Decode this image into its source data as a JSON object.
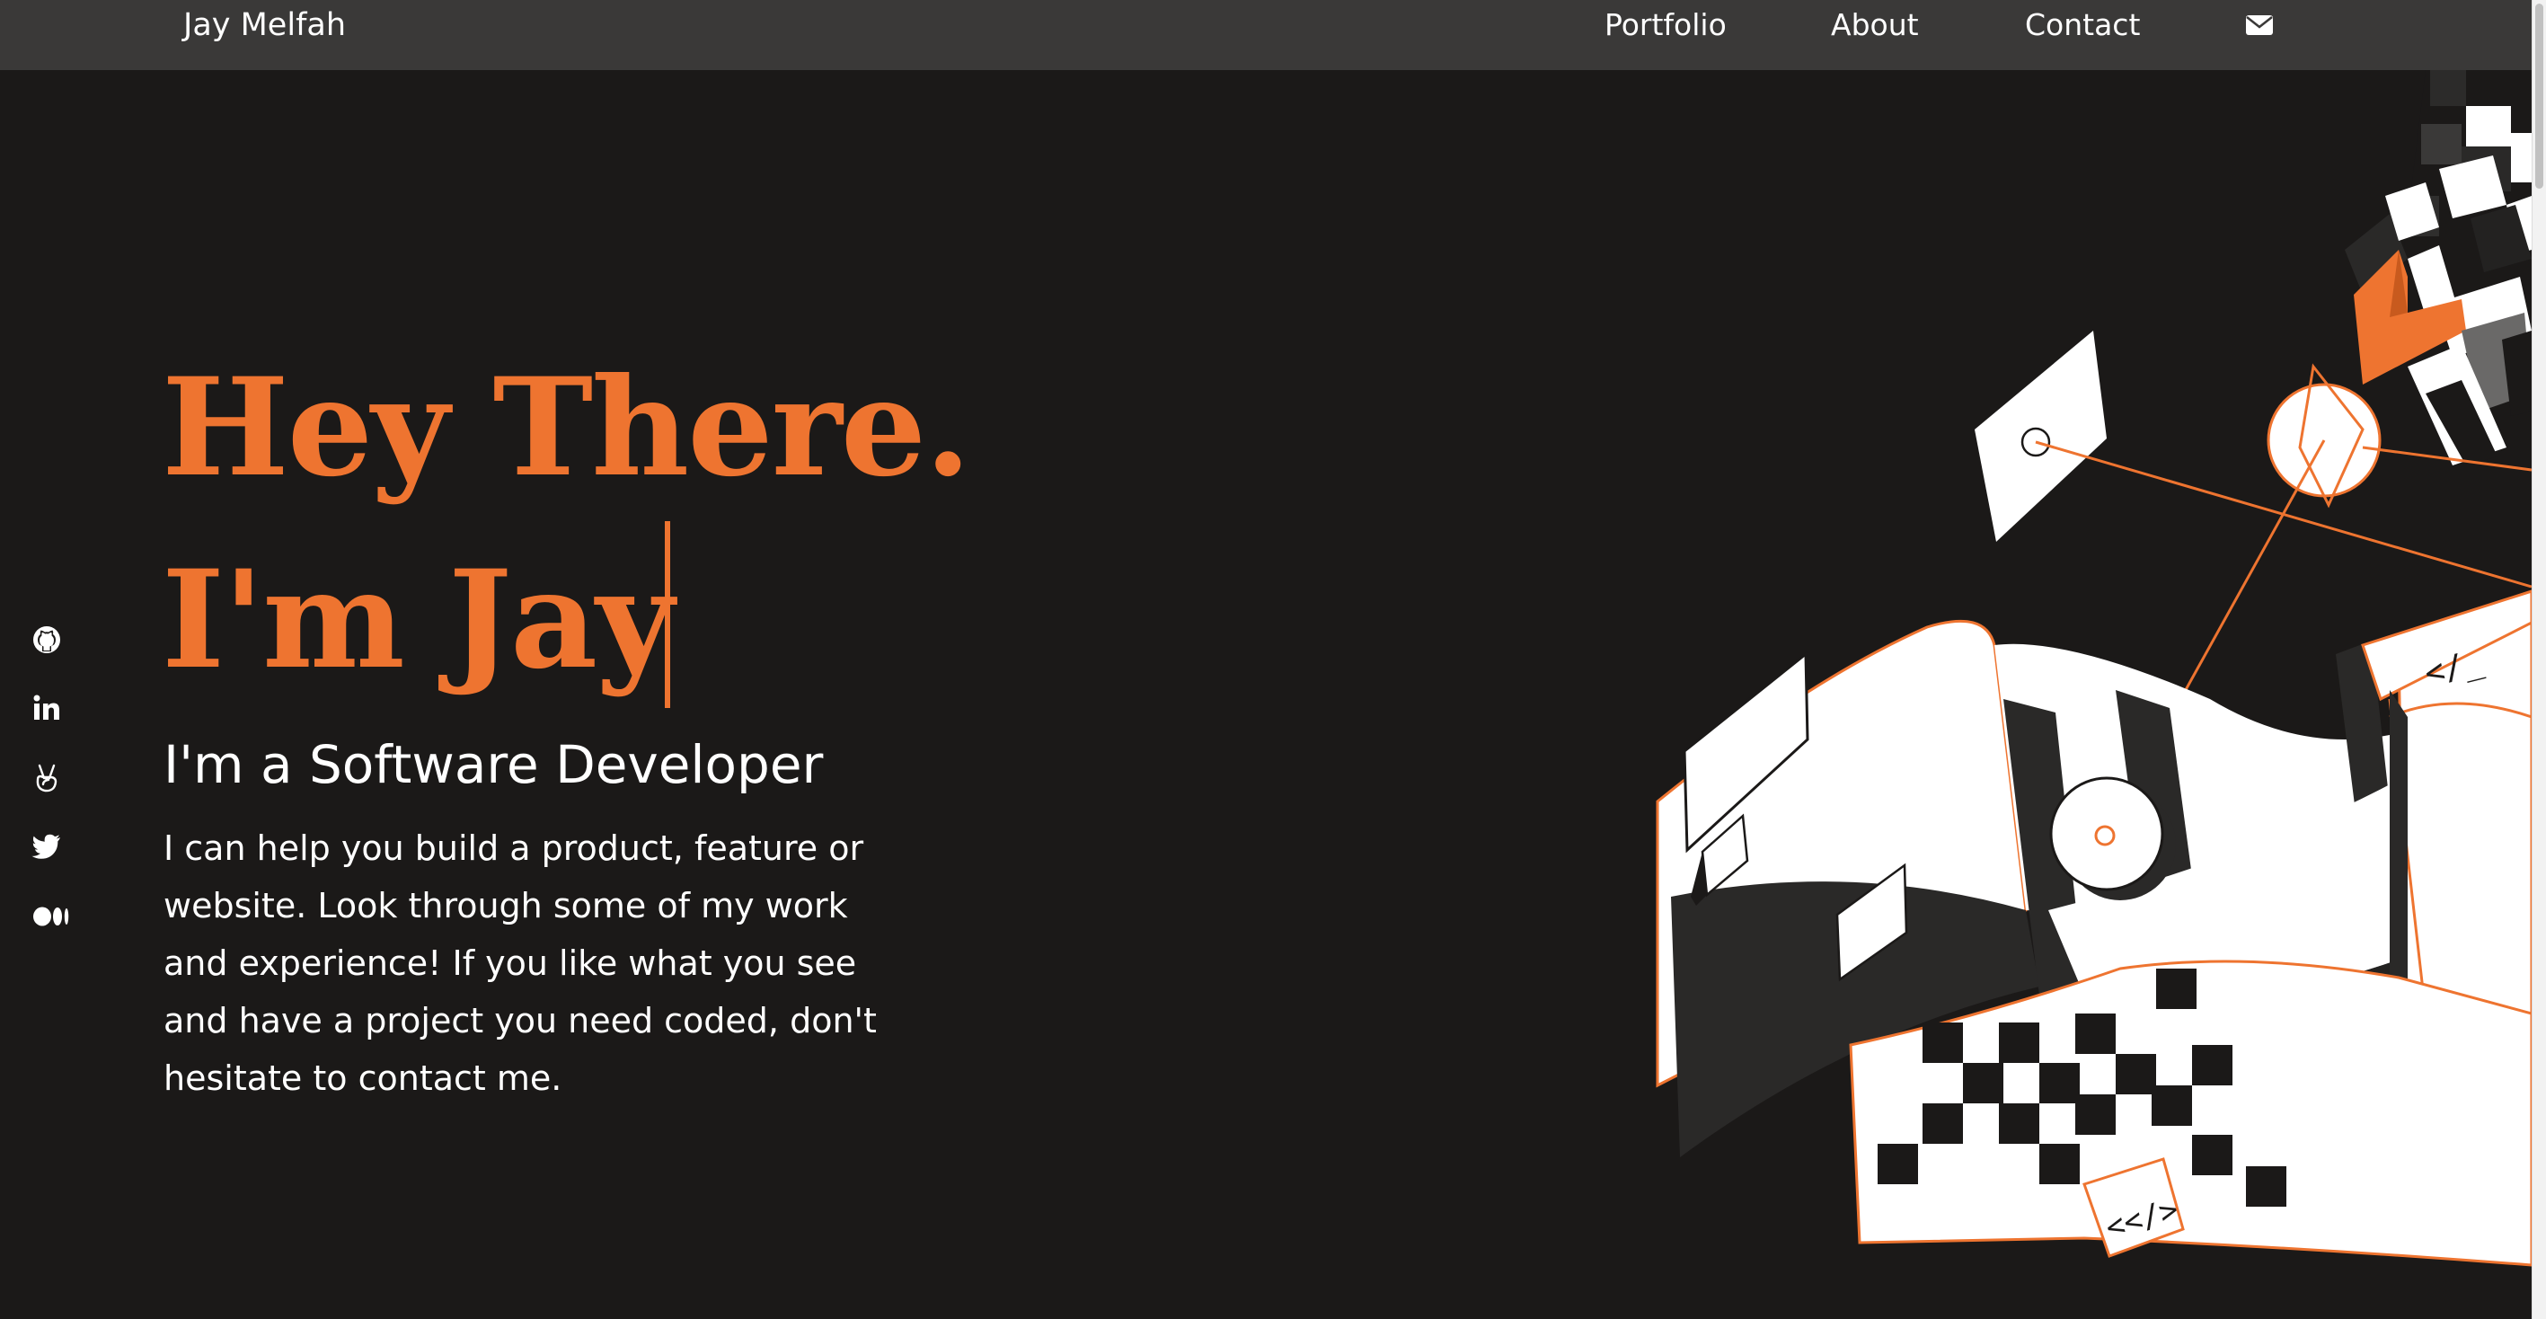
{
  "nav": {
    "brand": "Jay Melfah",
    "links": [
      {
        "label": "Portfolio"
      },
      {
        "label": "About"
      },
      {
        "label": "Contact"
      }
    ],
    "mail_icon": "envelope-icon"
  },
  "hero": {
    "line1": "Hey There.",
    "line2": "I'm Jay",
    "subtitle": "I'm a Software Developer",
    "description": "I can help you build a product, feature or website. Look through some of my work and experience! If you like what you see and have a project you need coded, don't hesitate to contact me."
  },
  "social": [
    {
      "icon": "github-icon"
    },
    {
      "icon": "linkedin-icon"
    },
    {
      "icon": "angellist-icon"
    },
    {
      "icon": "twitter-icon"
    },
    {
      "icon": "medium-icon"
    }
  ],
  "illustration": {
    "code_tag_bottom": "<</>",
    "code_tag_top": "</_"
  },
  "colors": {
    "accent": "#ee7430",
    "background": "#1b1918",
    "navbar": "#3a3938",
    "text": "#ffffff"
  }
}
